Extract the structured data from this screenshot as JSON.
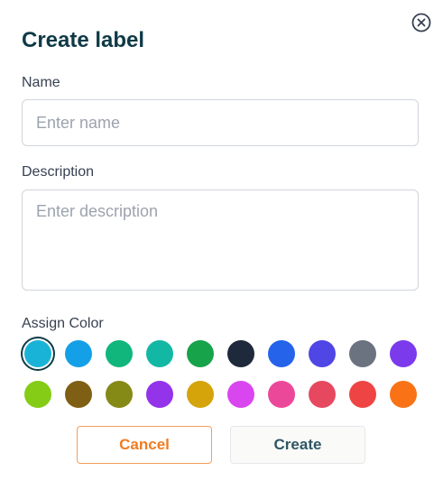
{
  "dialog": {
    "title": "Create label",
    "close_icon": "close-circle-icon"
  },
  "name_field": {
    "label": "Name",
    "placeholder": "Enter name",
    "value": ""
  },
  "description_field": {
    "label": "Description",
    "placeholder": "Enter description",
    "value": ""
  },
  "color_picker": {
    "label": "Assign Color",
    "selected_index": 0,
    "colors": [
      "#1ab3d8",
      "#14a0e6",
      "#10b67c",
      "#13b8a5",
      "#16a34a",
      "#1e293b",
      "#2563eb",
      "#4f46e5",
      "#6b7280",
      "#7c3aed",
      "#84cc16",
      "#7f5f13",
      "#858a17",
      "#9333ea",
      "#d4a40a",
      "#d946ef",
      "#ec4899",
      "#e64860",
      "#ef4444",
      "#f97316"
    ]
  },
  "actions": {
    "cancel_label": "Cancel",
    "create_label": "Create"
  },
  "theme": {
    "title_color": "#0f3a47",
    "cancel_accent": "#f07c22"
  }
}
